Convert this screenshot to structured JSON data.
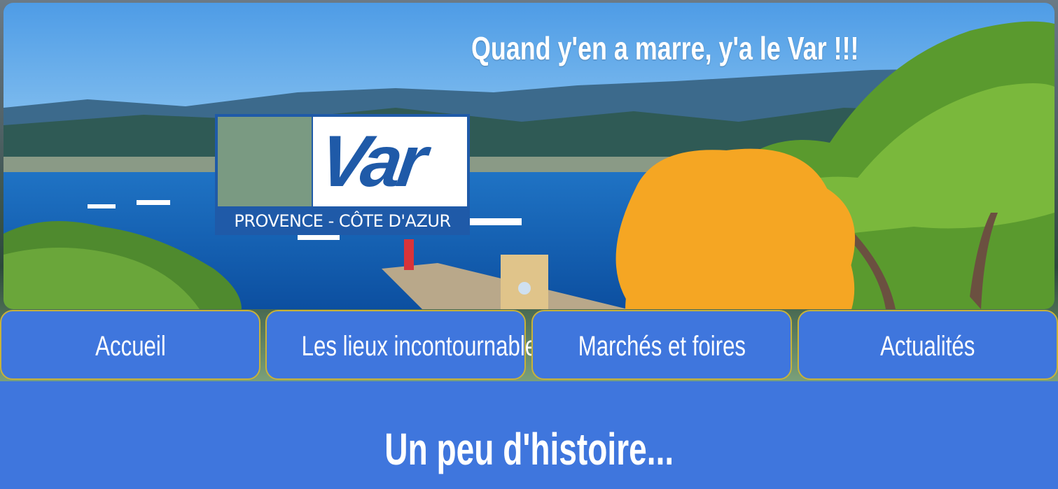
{
  "hero": {
    "tagline": "Quand y'en a marre, y'a le Var !!!",
    "logo": {
      "word": "Var",
      "subtitle": "PROVENCE - CÔTE D'AZUR"
    }
  },
  "nav": {
    "items": [
      {
        "label": "Accueil"
      },
      {
        "label": "Les lieux incontournables"
      },
      {
        "label": "Marchés et foires"
      },
      {
        "label": "Actualités"
      }
    ]
  },
  "main": {
    "heading": "Un peu d'histoire..."
  },
  "colors": {
    "nav_bg": "#3f76dd",
    "nav_border": "#c8b23a",
    "logo_blue": "#1f5aa8",
    "logo_orange": "#f5a623"
  }
}
